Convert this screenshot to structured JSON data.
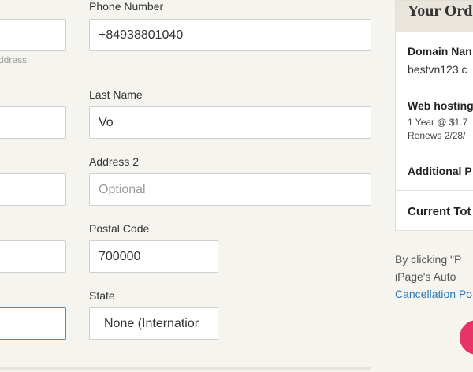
{
  "form": {
    "phone_label": "Phone Number",
    "phone_value": "+84938801040",
    "email_hint": "ddress.",
    "last_name_label": "Last Name",
    "last_name_value": "Vo",
    "address2_label": "Address 2",
    "address2_placeholder": "Optional",
    "postal_label": "Postal Code",
    "postal_value": "700000",
    "state_label": "State",
    "state_value": "None (Internatior"
  },
  "order": {
    "title": "Your Ord",
    "domain_label": "Domain Nan",
    "domain_value": "bestvn123.c",
    "hosting_label": "Web hosting",
    "hosting_term": "1 Year @ $1.7",
    "hosting_renew": "Renews 2/28/",
    "additional_label": "Additional P",
    "total_label": "Current Tot"
  },
  "terms": {
    "line1": "By  clicking  \"P",
    "line2": "iPage's  Auto",
    "link": "Cancellation Po"
  },
  "colors": {
    "accent": "#e8336a",
    "link": "#2a7ab8",
    "focus": "#3b8fd4"
  }
}
